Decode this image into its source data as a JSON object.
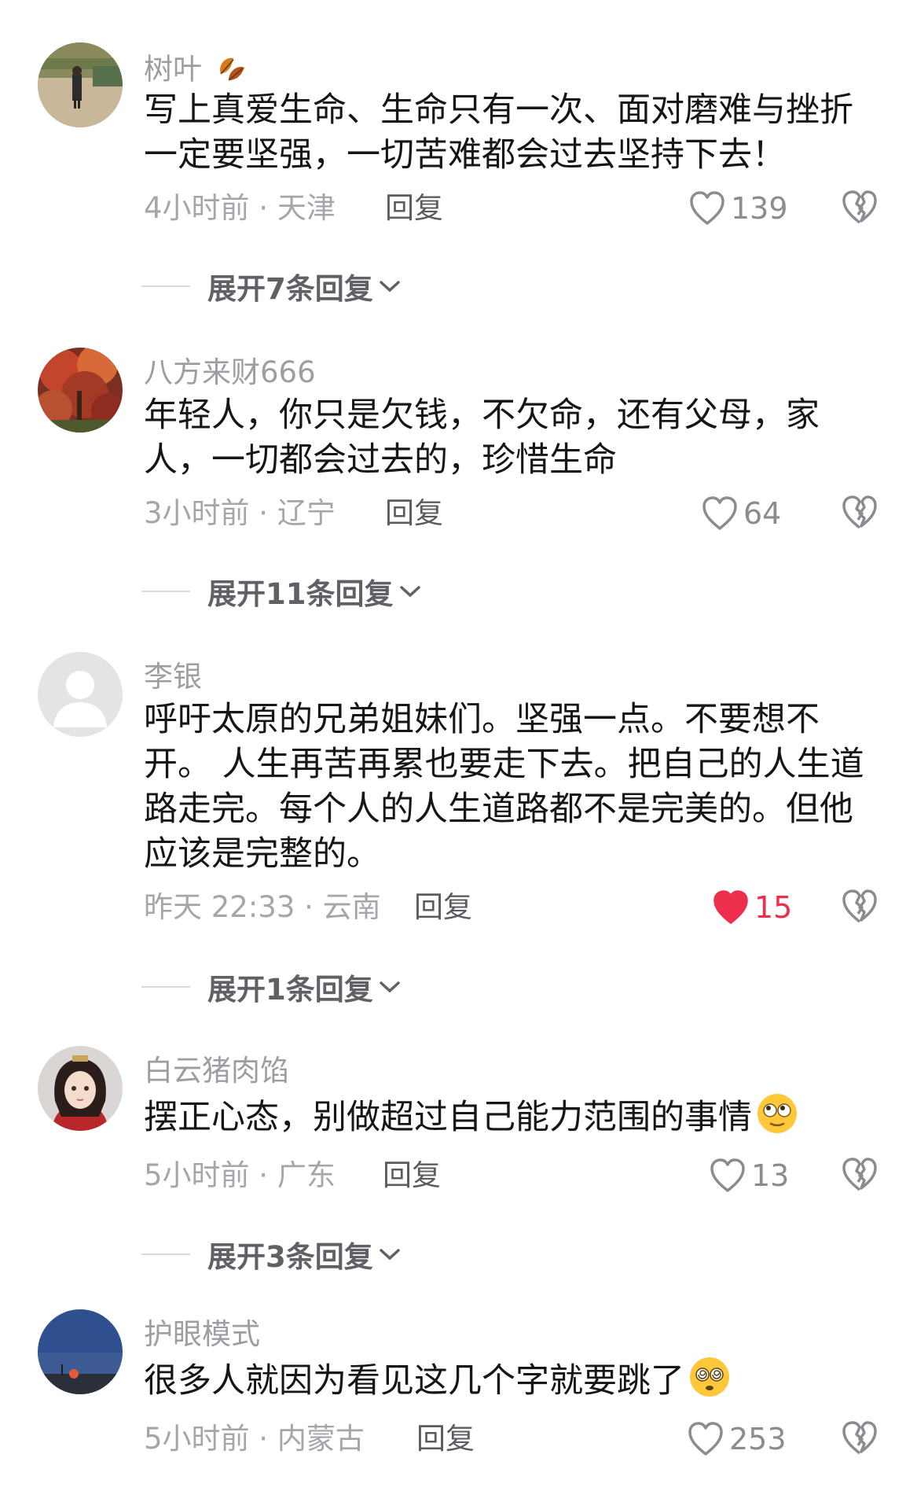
{
  "comments": [
    {
      "username": "树叶",
      "username_icon": "autumn-leaf-icon",
      "text": "写上真爱生命、生命只有一次、面对磨难与挫折一定要坚强，一切苦难都会过去坚持下去！",
      "meta": "4小时前 · 天津",
      "reply_label": "回复",
      "likes": "139",
      "liked": false,
      "expand_label": "展开7条回复"
    },
    {
      "username": "八方来财666",
      "text": "年轻人，你只是欠钱，不欠命，还有父母，家人，一切都会过去的，珍惜生命",
      "meta": "3小时前 · 辽宁",
      "reply_label": "回复",
      "likes": "64",
      "liked": false,
      "expand_label": "展开11条回复"
    },
    {
      "username": "李银",
      "text": "呼吁太原的兄弟姐妹们。坚强一点。不要想不开。 人生再苦再累也要走下去。把自己的人生道路走完。每个人的人生道路都不是完美的。但他应该是完整的。",
      "meta": "昨天 22:33 · 云南",
      "reply_label": "回复",
      "likes": "15",
      "liked": true,
      "expand_label": "展开1条回复"
    },
    {
      "username": "白云猪肉馅",
      "text": "摆正心态，别做超过自己能力范围的事情",
      "text_emoji": "rolling-eyes-emoji",
      "meta": "5小时前 · 广东",
      "reply_label": "回复",
      "likes": "13",
      "liked": false,
      "expand_label": "展开3条回复"
    },
    {
      "username": "护眼模式",
      "text": "很多人就因为看见这几个字就要跳了",
      "text_emoji": "dizzy-face-emoji",
      "meta": "5小时前 · 内蒙古",
      "reply_label": "回复",
      "likes": "253",
      "liked": false
    }
  ],
  "colors": {
    "like_active": "#ee2e4d",
    "muted_text": "#9c9ea3",
    "body_text": "#161616"
  }
}
